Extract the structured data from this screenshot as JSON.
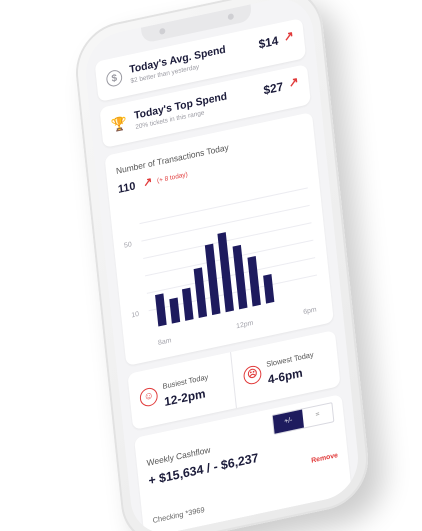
{
  "avg_spend": {
    "title": "Today's Avg. Spend",
    "subtitle": "$2 better than yesterday",
    "value": "$14",
    "arrow": "↗"
  },
  "top_spend": {
    "title": "Today's Top Spend",
    "subtitle": "20% tickets in this range",
    "value": "$27",
    "arrow": "↗"
  },
  "transactions": {
    "title": "Number of Transactions Today",
    "count": "110",
    "arrow": "↗",
    "delta": "(+ 8 today)"
  },
  "chart_data": {
    "type": "bar",
    "title": "Number of Transactions Today",
    "x_tick_labels": [
      "8am",
      "12pm",
      "6pm"
    ],
    "y_tick_labels": [
      "50",
      "10"
    ],
    "y_ticks": [
      50,
      10
    ],
    "ylim": [
      0,
      70
    ],
    "values": [
      18,
      14,
      18,
      28,
      40,
      45,
      36,
      28,
      16
    ],
    "bar_color": "#1e1b5e",
    "grid": true
  },
  "busiest": {
    "label": "Busiest Today",
    "value": "12-2pm"
  },
  "slowest": {
    "label": "Slowest Today",
    "value": "4-6pm"
  },
  "cashflow": {
    "title": "Weekly Cashflow",
    "amount": "+ $15,634 / - $6,237",
    "toggle": [
      "+/-",
      "="
    ],
    "remove": "Remove",
    "account": "Checking *3969"
  },
  "colors": {
    "accent": "#e13b3b",
    "navy": "#1e1b5e"
  },
  "icons": {
    "avg": "dollar-circle-icon",
    "top": "trophy-icon",
    "busy": "smile-face-icon",
    "slow": "sad-face-icon"
  }
}
